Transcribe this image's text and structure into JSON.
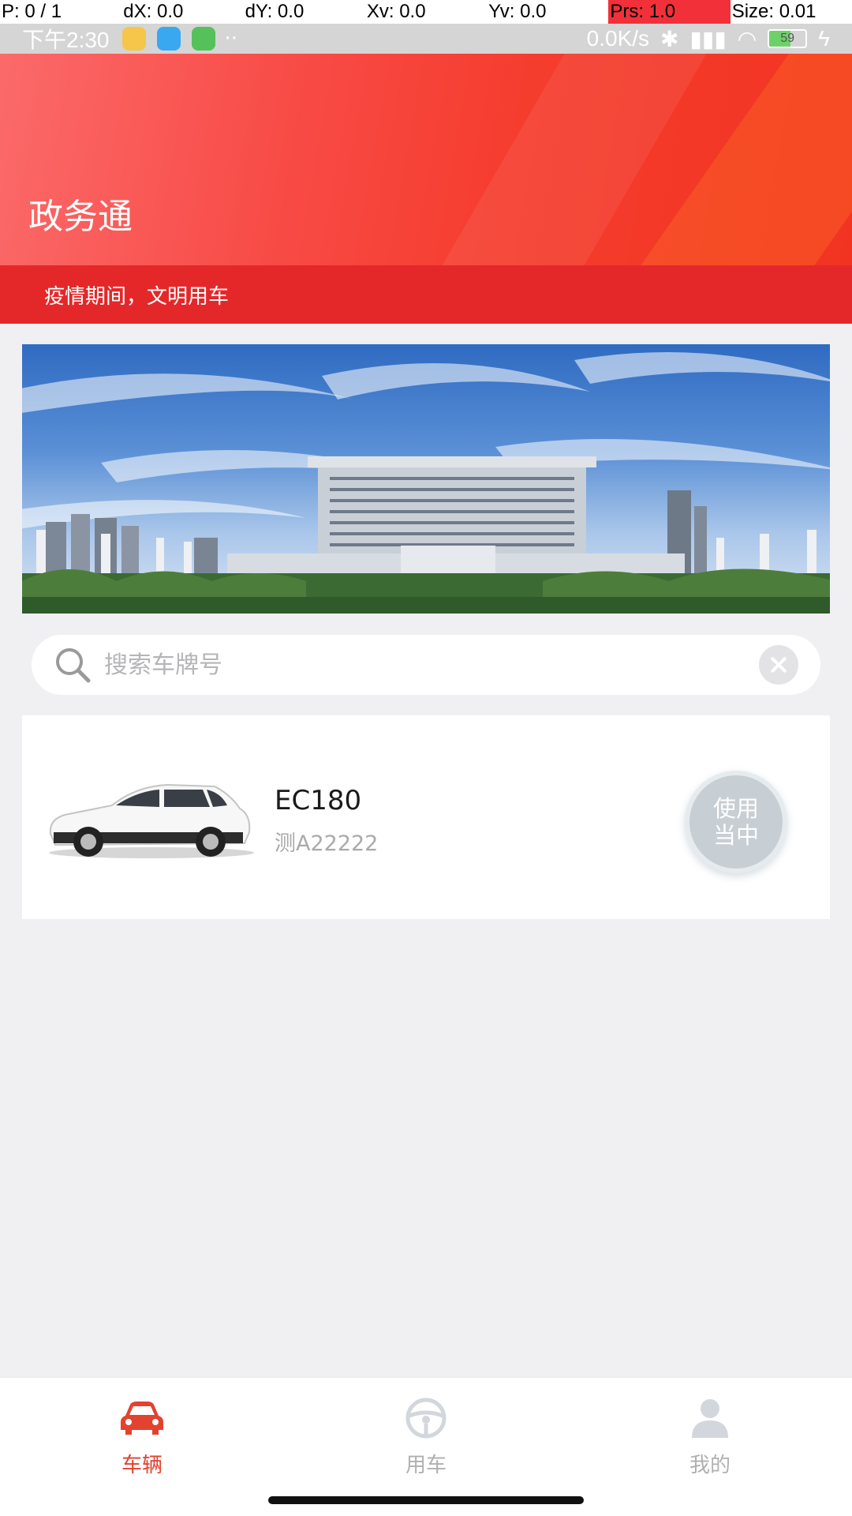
{
  "debug": {
    "cells": [
      "P: 0 / 1",
      "dX: 0.0",
      "dY: 0.0",
      "Xv: 0.0",
      "Yv: 0.0",
      "Prs: 1.0",
      "Size: 0.01"
    ]
  },
  "status_bar": {
    "time": "下午2:30",
    "net_speed": "0.0K/s",
    "battery": "59"
  },
  "header": {
    "title": "政务通",
    "notice": "疫情期间，文明用车"
  },
  "search": {
    "placeholder": "搜索车牌号"
  },
  "vehicles": [
    {
      "model": "EC180",
      "plate": "测A22222",
      "status_label": "使用当中"
    }
  ],
  "tabs": [
    {
      "label": "车辆",
      "icon": "car-icon",
      "active": true
    },
    {
      "label": "用车",
      "icon": "steering-wheel-icon",
      "active": false
    },
    {
      "label": "我的",
      "icon": "user-icon",
      "active": false
    }
  ],
  "colors": {
    "accent": "#e2422e",
    "header_red": "#f53d2e",
    "notice_red": "#e4282a",
    "background": "#f0eff2"
  }
}
